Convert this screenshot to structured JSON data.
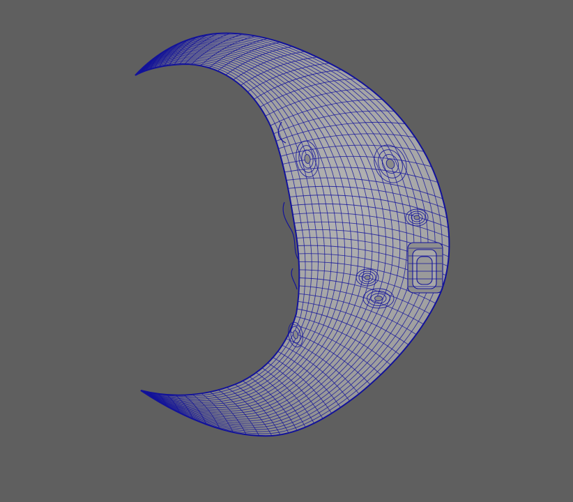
{
  "viewport": {
    "background_color": "#5f5f5f",
    "object": {
      "name": "crescent-moon-face",
      "shading": "smooth-shaded-with-wireframe",
      "surface_color": "#9c9c9c",
      "wireframe_color": "#12129a"
    }
  }
}
